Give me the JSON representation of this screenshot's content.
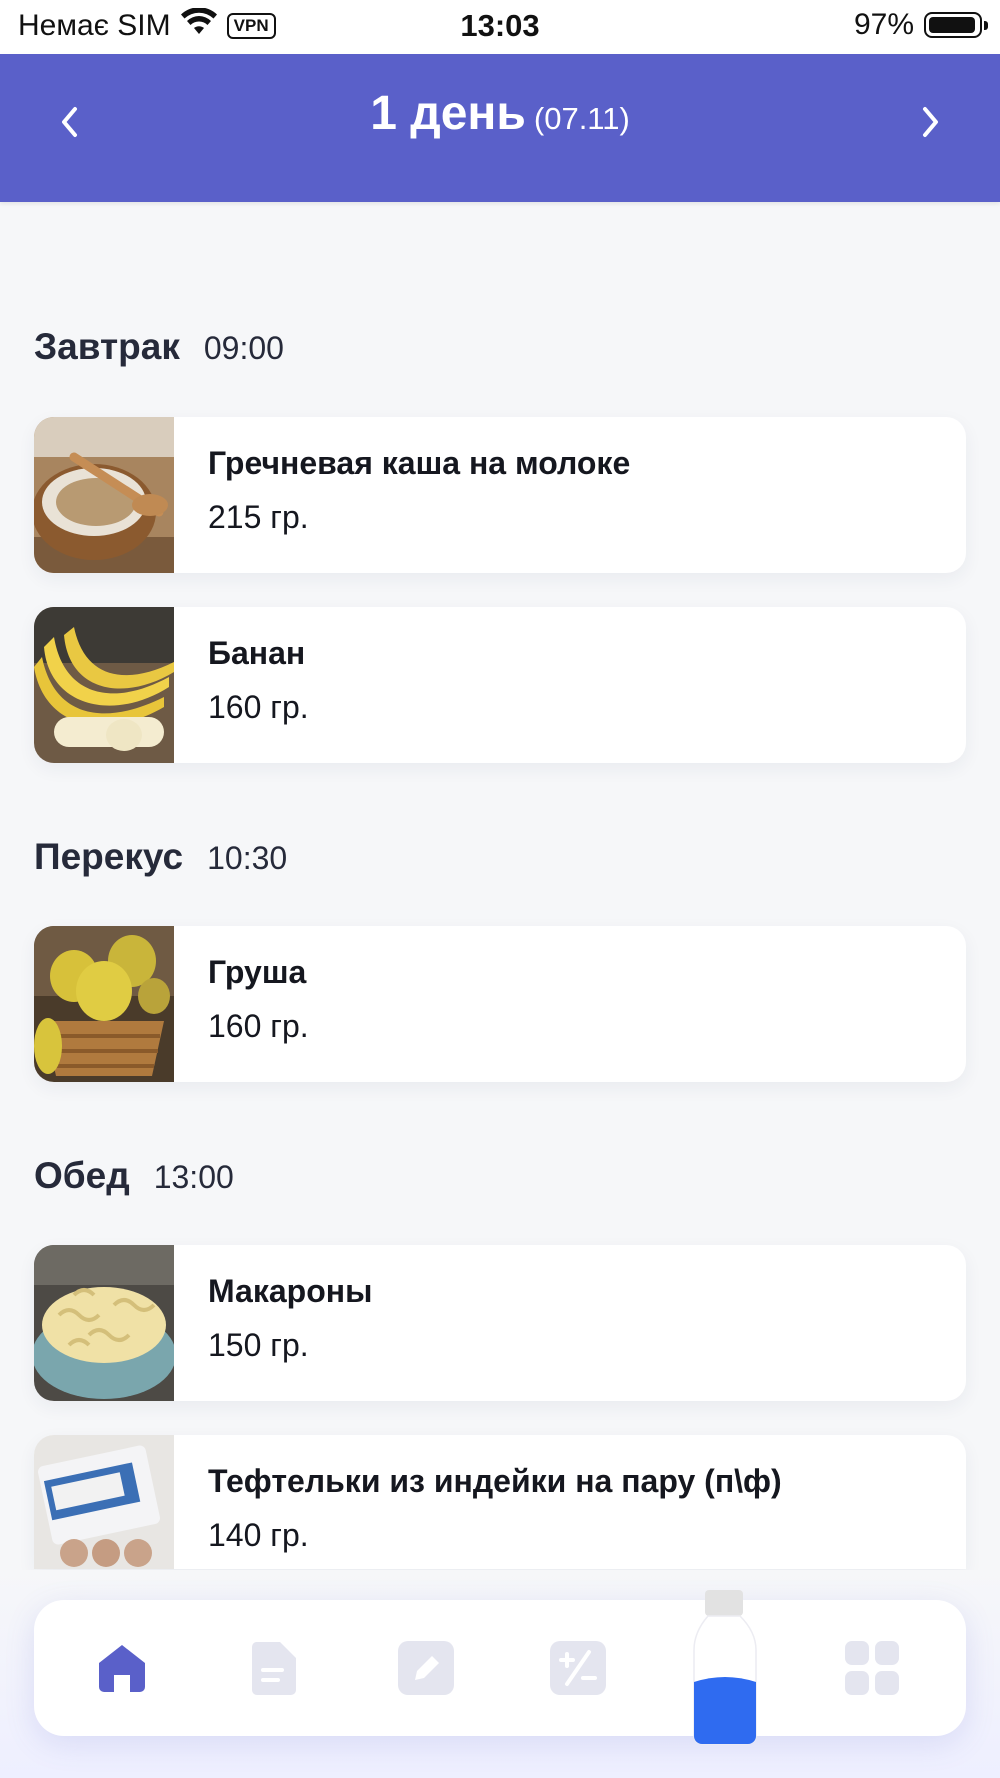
{
  "status_bar": {
    "carrier": "Немає SIM",
    "vpn": "VPN",
    "time": "13:03",
    "battery": "97%"
  },
  "header": {
    "title": "1 день",
    "date": "(07.11)",
    "prev_icon": "chevron-left-icon",
    "next_icon": "chevron-right-icon",
    "color": "#5a60c9"
  },
  "meals": [
    {
      "name": "Завтрак",
      "time": "09:00",
      "items": [
        {
          "name": "Гречневая каша на молоке",
          "amount": "215 гр."
        },
        {
          "name": "Банан",
          "amount": "160 гр."
        }
      ]
    },
    {
      "name": "Перекус",
      "time": "10:30",
      "items": [
        {
          "name": "Груша",
          "amount": "160 гр."
        }
      ]
    },
    {
      "name": "Обед",
      "time": "13:00",
      "items": [
        {
          "name": "Макароны",
          "amount": "150 гр."
        },
        {
          "name": "Тефтельки из индейки на пару (п\\ф)",
          "amount": "140 гр."
        }
      ]
    }
  ],
  "tabbar": {
    "tabs": [
      "home-icon",
      "document-icon",
      "edit-icon",
      "calculator-icon",
      "water-bottle-icon",
      "grid-icon"
    ],
    "active": "home-icon",
    "active_color": "#5a60c9",
    "inactive_color": "#e4e5ef",
    "water_color": "#2f6bf0"
  }
}
